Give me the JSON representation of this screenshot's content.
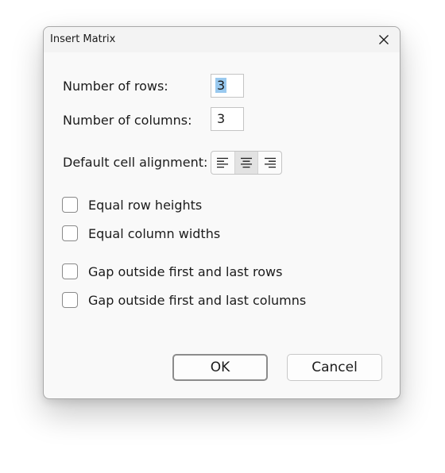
{
  "dialog": {
    "title": "Insert Matrix",
    "close_icon": "close-icon"
  },
  "rows": {
    "label": "Number of rows:",
    "value": "3"
  },
  "columns": {
    "label": "Number of columns:",
    "value": "3"
  },
  "alignment": {
    "label": "Default cell alignment:",
    "options": [
      "align-left-icon",
      "align-center-icon",
      "align-right-icon"
    ],
    "selected": "center"
  },
  "options": {
    "equal_row_heights": "Equal row heights",
    "equal_column_widths": "Equal column widths",
    "gap_rows": "Gap outside first and last rows",
    "gap_columns": "Gap outside first and last columns"
  },
  "buttons": {
    "ok": "OK",
    "cancel": "Cancel"
  }
}
